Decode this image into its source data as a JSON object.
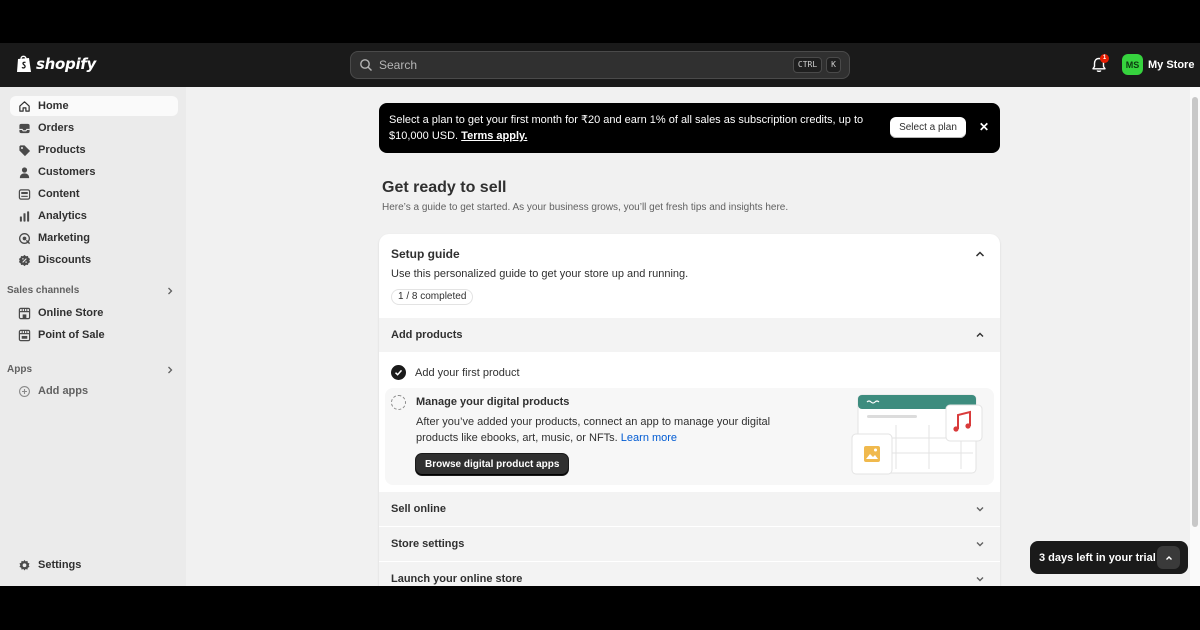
{
  "header": {
    "brand": "shopify",
    "search_placeholder": "Search",
    "shortcut_keys": [
      "CTRL",
      "K"
    ],
    "notification_count": "1",
    "store_initials": "MS",
    "store_name": "My Store"
  },
  "sidebar": {
    "items": [
      {
        "label": "Home",
        "icon": "home-icon"
      },
      {
        "label": "Orders",
        "icon": "inbox-icon"
      },
      {
        "label": "Products",
        "icon": "tag-icon"
      },
      {
        "label": "Customers",
        "icon": "person-icon"
      },
      {
        "label": "Content",
        "icon": "content-icon"
      },
      {
        "label": "Analytics",
        "icon": "bar-chart-icon"
      },
      {
        "label": "Marketing",
        "icon": "target-icon"
      },
      {
        "label": "Discounts",
        "icon": "discount-icon"
      }
    ],
    "sales_channels_label": "Sales channels",
    "sales_channels": [
      {
        "label": "Online Store",
        "icon": "storefront-icon"
      },
      {
        "label": "Point of Sale",
        "icon": "pos-icon"
      }
    ],
    "apps_label": "Apps",
    "add_apps_label": "Add apps",
    "settings_label": "Settings"
  },
  "banner": {
    "text": "Select a plan to get your first month for ₹20 and earn 1% of all sales as subscription credits, up to $10,000 USD.",
    "link": "Terms apply.",
    "button": "Select a plan"
  },
  "main": {
    "title": "Get ready to sell",
    "subtitle": "Here’s a guide to get started. As your business grows, you’ll get fresh tips and insights here."
  },
  "setup_guide": {
    "title": "Setup guide",
    "description": "Use this personalized guide to get your store up and running.",
    "progress": "1 / 8 completed",
    "sections": [
      {
        "label": "Add products",
        "expanded": true
      },
      {
        "label": "Sell online",
        "expanded": false
      },
      {
        "label": "Store settings",
        "expanded": false
      },
      {
        "label": "Launch your online store",
        "expanded": false
      }
    ],
    "tasks": {
      "done": "Add your first product",
      "active_title": "Manage your digital products",
      "active_body": "After you’ve added your products, connect an app to manage your digital products like ebooks, art, music, or NFTs.",
      "learn_more": "Learn more",
      "active_button": "Browse digital product apps"
    }
  },
  "trial": {
    "label": "3 days left in your trial"
  },
  "colors": {
    "topbar": "#1a1a1a",
    "avatar": "#36d33e",
    "link": "#005bd3",
    "badge": "#e51c00"
  }
}
